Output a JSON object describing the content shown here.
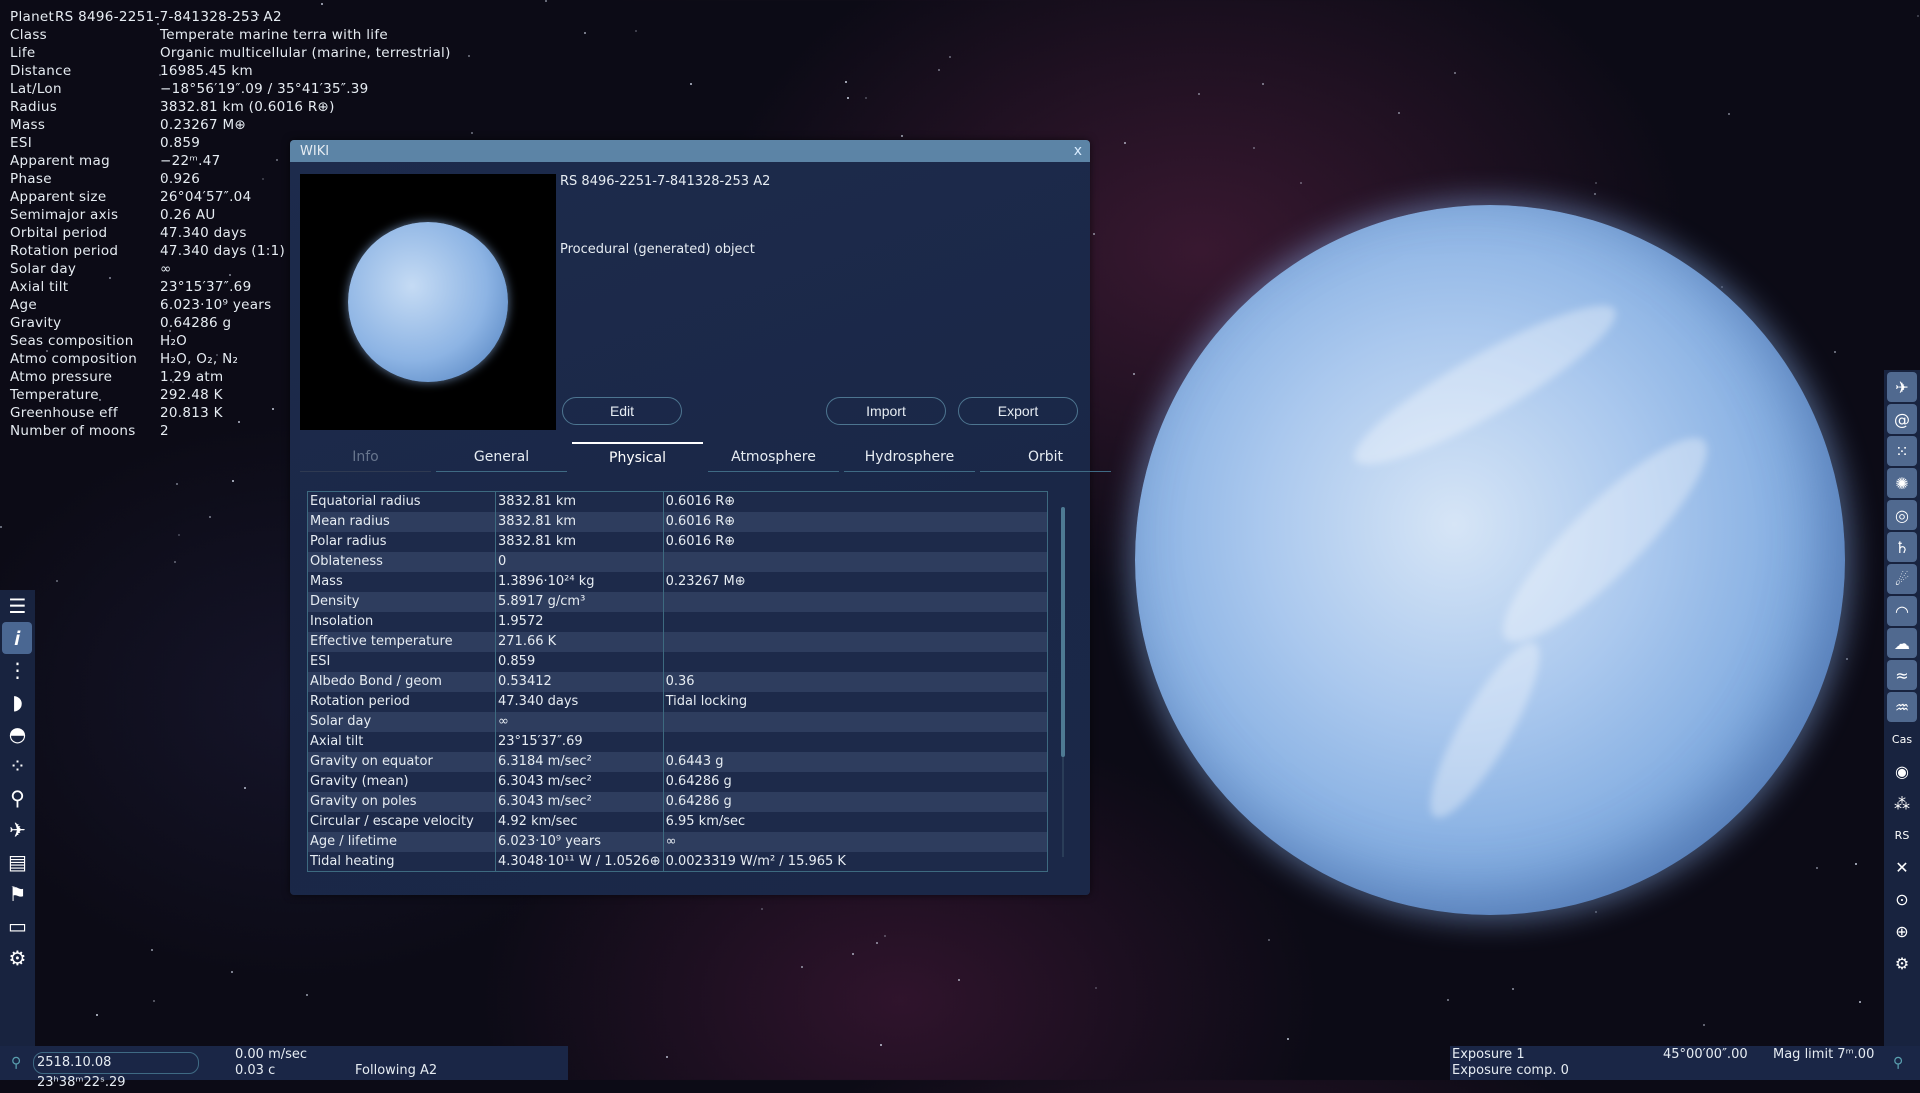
{
  "info_panel": {
    "title_label": "Planet",
    "title_value": "RS 8496-2251-7-841328-253 A2",
    "rows": [
      [
        "Class",
        "Temperate marine terra with life"
      ],
      [
        "Life",
        "Organic multicellular (marine, terrestrial)"
      ],
      [
        "Distance",
        "16985.45 km"
      ],
      [
        "Lat/Lon",
        "−18°56′19″.09 / 35°41′35″.39"
      ],
      [
        "Radius",
        "3832.81 km (0.6016 R⊕)"
      ],
      [
        "Mass",
        "0.23267 M⊕"
      ],
      [
        "ESI",
        "0.859"
      ],
      [
        "Apparent mag",
        "−22ᵐ.47"
      ],
      [
        "Phase",
        "0.926"
      ],
      [
        "Apparent size",
        "26°04′57″.04"
      ],
      [
        "Semimajor axis",
        "0.26 AU"
      ],
      [
        "Orbital period",
        "47.340 days"
      ],
      [
        "Rotation period",
        "47.340 days (1:1)"
      ],
      [
        "Solar day",
        "∞"
      ],
      [
        "Axial tilt",
        "23°15′37″.69"
      ],
      [
        "Age",
        "6.023·10⁹ years"
      ],
      [
        "Gravity",
        "0.64286 g"
      ],
      [
        "Seas composition",
        "H₂O"
      ],
      [
        "Atmo composition",
        "H₂O, O₂, N₂"
      ],
      [
        "Atmo pressure",
        "1.29 atm"
      ],
      [
        "Temperature",
        "292.48 K"
      ],
      [
        "Greenhouse eff",
        "20.813 K"
      ],
      [
        "Number of moons",
        "2"
      ]
    ]
  },
  "wiki": {
    "title": "WIKI",
    "close": "x",
    "object_name": "RS 8496-2251-7-841328-253 A2",
    "description": "Procedural (generated) object",
    "buttons": {
      "edit": "Edit",
      "import": "Import",
      "export": "Export"
    },
    "tabs": [
      "Info",
      "General",
      "Physical",
      "Atmosphere",
      "Hydrosphere",
      "Orbit"
    ],
    "active_tab": "Physical",
    "table": [
      [
        "Equatorial radius",
        "3832.81 km",
        "0.6016 R⊕"
      ],
      [
        "Mean radius",
        "3832.81 km",
        "0.6016 R⊕"
      ],
      [
        "Polar radius",
        "3832.81 km",
        "0.6016 R⊕"
      ],
      [
        "Oblateness",
        "0",
        ""
      ],
      [
        "Mass",
        "1.3896·10²⁴ kg",
        "0.23267 M⊕"
      ],
      [
        "Density",
        "5.8917 g/cm³",
        ""
      ],
      [
        "Insolation",
        "1.9572",
        ""
      ],
      [
        "Effective temperature",
        "271.66 K",
        ""
      ],
      [
        "ESI",
        "0.859",
        ""
      ],
      [
        "Albedo Bond / geom",
        "0.53412",
        "0.36"
      ],
      [
        "Rotation period",
        "47.340 days",
        "Tidal locking"
      ],
      [
        "Solar day",
        "∞",
        ""
      ],
      [
        "Axial tilt",
        "23°15′37″.69",
        ""
      ],
      [
        "Gravity on equator",
        "6.3184 m/sec²",
        "0.6443 g"
      ],
      [
        "Gravity (mean)",
        "6.3043 m/sec²",
        "0.64286 g"
      ],
      [
        "Gravity on poles",
        "6.3043 m/sec²",
        "0.64286 g"
      ],
      [
        "Circular / escape velocity",
        "4.92 km/sec",
        "6.95 km/sec"
      ],
      [
        "Age / lifetime",
        "6.023·10⁹ years",
        "∞"
      ],
      [
        "Tidal heating",
        "4.3048·10¹¹ W / 1.0526⊕",
        "0.0023319 W/m² / 15.965 K"
      ]
    ]
  },
  "bottom_left": {
    "datetime": "2518.10.08 23ʰ38ᵐ22ˢ.29",
    "speed": "0.00 m/sec",
    "speed_c": "0.03 c",
    "mode": "Following A2"
  },
  "bottom_right": {
    "exposure": "Exposure 1",
    "exposure_comp": "Exposure comp. 0",
    "fov": "45°00′00″.00",
    "mag_limit": "Mag limit 7ᵐ.00"
  },
  "left_toolbar": [
    [
      "menu-icon",
      "☰"
    ],
    [
      "info-icon",
      "𝒊"
    ],
    [
      "planetarium-icon",
      "⋮"
    ],
    [
      "solar-system-icon",
      "◗"
    ],
    [
      "observatory-icon",
      "◓"
    ],
    [
      "stars-icon",
      "⁘"
    ],
    [
      "search-icon",
      "⚲"
    ],
    [
      "spaceship-icon",
      "✈"
    ],
    [
      "notepad-icon",
      "▤"
    ],
    [
      "flag-icon",
      "⚑"
    ],
    [
      "display-icon",
      "▭"
    ],
    [
      "settings-icon",
      "⚙"
    ]
  ],
  "right_toolbar": [
    [
      "spaceship-filter-icon",
      "✈"
    ],
    [
      "galaxy-icon",
      "@"
    ],
    [
      "star-cluster-icon",
      "⁙"
    ],
    [
      "nebula-icon",
      "✺"
    ],
    [
      "planetary-nebula-icon",
      "◎"
    ],
    [
      "planet-icon",
      "♄"
    ],
    [
      "comet-icon",
      "☄"
    ],
    [
      "atmosphere-icon",
      "◠"
    ],
    [
      "clouds-icon",
      "☁"
    ],
    [
      "water-icon",
      "≈"
    ],
    [
      "aurora-icon",
      "♒"
    ],
    [
      "constellation-icon",
      "Cas"
    ],
    [
      "orbit-icon",
      "◉"
    ],
    [
      "markers-icon",
      "⁂"
    ],
    [
      "labels-icon",
      "RS"
    ],
    [
      "crosshair-icon",
      "✕"
    ],
    [
      "target-icon",
      "⊙"
    ],
    [
      "grid-icon",
      "⊕"
    ],
    [
      "settings-icon",
      "⚙"
    ]
  ],
  "colors": {
    "window_title": "#5c84a6",
    "window_bg": "#1b2848",
    "toolbar_bg": "#18233f",
    "accent_border": "#3f6a84"
  }
}
